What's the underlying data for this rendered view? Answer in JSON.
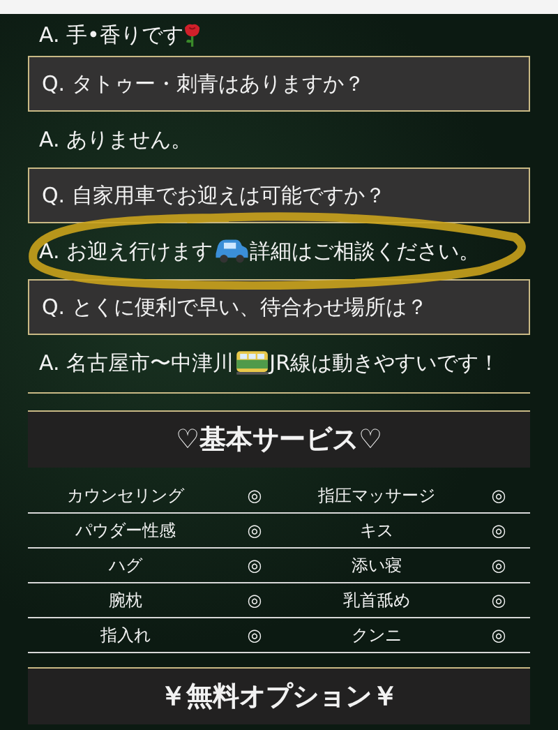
{
  "qa": [
    {
      "kind": "answer",
      "text": "A. 手•香りです"
    },
    {
      "kind": "question",
      "text": "Q. タトゥー・刺青はありますか？"
    },
    {
      "kind": "answer",
      "text": "A. ありません。"
    },
    {
      "kind": "question",
      "text": "Q. 自家用車でお迎えは可能ですか？"
    },
    {
      "kind": "answer",
      "text": "A. お迎え行けます",
      "text_after": "詳細はご相談ください。"
    },
    {
      "kind": "question",
      "text": "Q. とくに便利で早い、待合わせ場所は？"
    },
    {
      "kind": "answer",
      "text": "A. 名古屋市〜中津川",
      "text_after": "JR線は動きやすいです！"
    }
  ],
  "basic_services": {
    "title": "♡基本サービス♡",
    "items": [
      {
        "name": "カウンセリング",
        "mark": "◎"
      },
      {
        "name": "指圧マッサージ",
        "mark": "◎"
      },
      {
        "name": "パウダー性感",
        "mark": "◎"
      },
      {
        "name": "キス",
        "mark": "◎"
      },
      {
        "name": "ハグ",
        "mark": "◎"
      },
      {
        "name": "添い寝",
        "mark": "◎"
      },
      {
        "name": "腕枕",
        "mark": "◎"
      },
      {
        "name": "乳首舐め",
        "mark": "◎"
      },
      {
        "name": "指入れ",
        "mark": "◎"
      },
      {
        "name": "クンニ",
        "mark": "◎"
      }
    ]
  },
  "free_options": {
    "title": "￥無料オプション￥"
  }
}
